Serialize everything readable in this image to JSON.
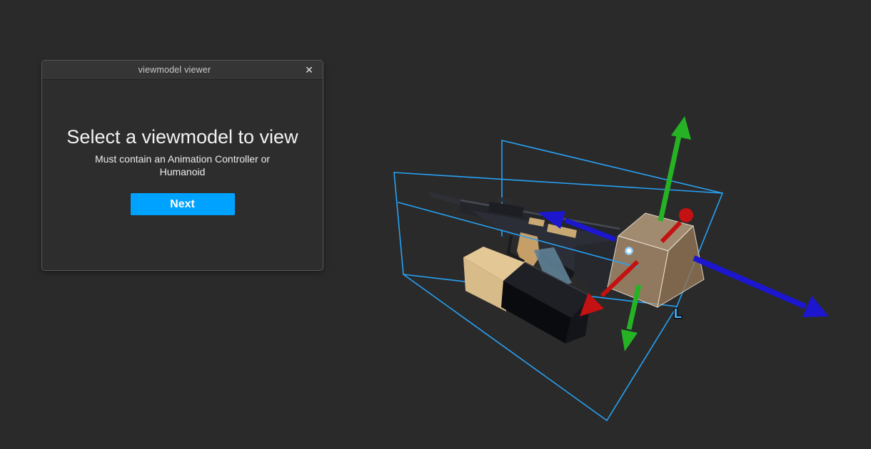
{
  "window": {
    "title": "viewmodel viewer",
    "close_glyph": "✕"
  },
  "dialog": {
    "heading": "Select a viewmodel to view",
    "subtext": "Must contain an Animation Controller or Humanoid",
    "next_label": "Next"
  },
  "viewport": {
    "axis_label": "L",
    "selection": "viewmodel bounding box",
    "tool": "move-tool arrows (x red, y green, z blue)"
  },
  "colors": {
    "background": "#2a2a2a",
    "accent": "#00a2ff",
    "wire": "#27a2f5",
    "axis_green": "#25b325",
    "axis_red": "#c41111",
    "axis_blue": "#1c17cf"
  }
}
